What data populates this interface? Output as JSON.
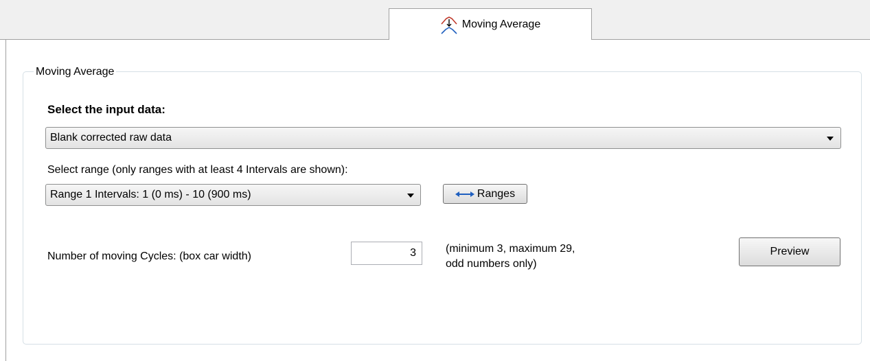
{
  "tab": {
    "label": "Moving Average",
    "icon": "moving-average-icon"
  },
  "group": {
    "title": "Moving Average"
  },
  "input_data": {
    "heading": "Select the input data:",
    "selected": "Blank corrected raw data"
  },
  "range": {
    "label": "Select range (only ranges with at least 4 Intervals are shown):",
    "selected": "Range 1 Intervals: 1 (0 ms) - 10 (900 ms)",
    "ranges_button_label": "Ranges",
    "ranges_button_icon": "double-arrow-icon"
  },
  "cycles": {
    "label": "Number of moving Cycles: (box car width)",
    "value": "3",
    "hint_line1": "(minimum 3, maximum 29,",
    "hint_line2": "odd numbers only)"
  },
  "preview_button_label": "Preview",
  "colors": {
    "tab_strip": "#f0f0f0",
    "border": "#a0a0a0",
    "groupbox_border": "#d5dfe5",
    "icon_red": "#c0392b",
    "icon_blue": "#1f5fbf"
  }
}
